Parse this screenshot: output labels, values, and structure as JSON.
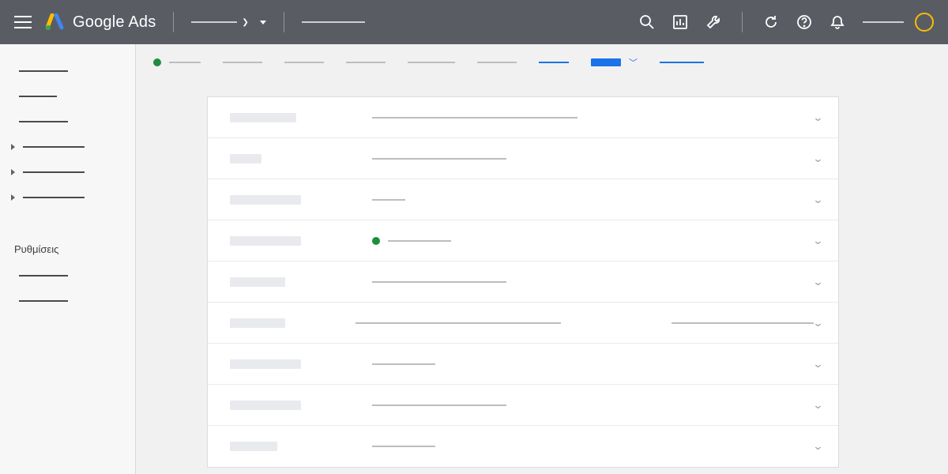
{
  "header": {
    "product_name": "Google Ads",
    "icons": {
      "menu": "menu-icon",
      "search": "search-icon",
      "reports": "reports-icon",
      "tools": "tools-icon",
      "refresh": "refresh-icon",
      "help": "help-icon",
      "notifications": "notifications-icon"
    }
  },
  "sidebar": {
    "items": [
      {
        "type": "line",
        "width": "sw-50"
      },
      {
        "type": "line",
        "width": "sw-40"
      },
      {
        "type": "line",
        "width": "sw-50"
      },
      {
        "type": "expandable",
        "width": "sw-70"
      },
      {
        "type": "expandable",
        "width": "sw-70"
      },
      {
        "type": "expandable",
        "width": "sw-70"
      }
    ],
    "active_label": "Ρυθμίσεις",
    "bottom_items": [
      {
        "type": "line",
        "width": "sw-50"
      },
      {
        "type": "line",
        "width": "sw-50"
      }
    ]
  },
  "breadcrumb": {
    "status": "enabled",
    "status_color": "#1e8e3e"
  },
  "settings": {
    "rows": [
      {
        "label_w": "lw-80",
        "value_type": "line",
        "value_w": "vw-long"
      },
      {
        "label_w": "lw-40",
        "value_type": "line",
        "value_w": "vw-med"
      },
      {
        "label_w": "lw-90",
        "value_type": "line",
        "value_w": "vw-short"
      },
      {
        "label_w": "lw-90",
        "value_type": "status",
        "value_w": "vw-80",
        "status_color": "#1e8e3e"
      },
      {
        "label_w": "lw-70",
        "value_type": "line",
        "value_w": "vw-med"
      },
      {
        "label_w": "lw-70",
        "value_type": "double",
        "value_w": "vw-long"
      },
      {
        "label_w": "lw-90",
        "value_type": "line",
        "value_w": "vw-80"
      },
      {
        "label_w": "lw-90",
        "value_type": "line",
        "value_w": "vw-med"
      },
      {
        "label_w": "lw-60",
        "value_type": "line",
        "value_w": "vw-80"
      }
    ]
  }
}
